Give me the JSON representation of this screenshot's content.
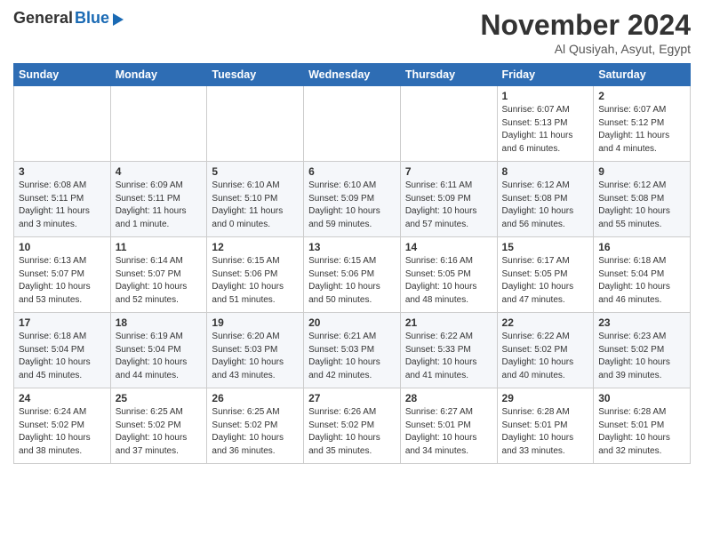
{
  "header": {
    "logo_general": "General",
    "logo_blue": "Blue",
    "month_title": "November 2024",
    "location": "Al Qusiyah, Asyut, Egypt"
  },
  "weekdays": [
    "Sunday",
    "Monday",
    "Tuesday",
    "Wednesday",
    "Thursday",
    "Friday",
    "Saturday"
  ],
  "weeks": [
    [
      {
        "day": "",
        "info": ""
      },
      {
        "day": "",
        "info": ""
      },
      {
        "day": "",
        "info": ""
      },
      {
        "day": "",
        "info": ""
      },
      {
        "day": "",
        "info": ""
      },
      {
        "day": "1",
        "info": "Sunrise: 6:07 AM\nSunset: 5:13 PM\nDaylight: 11 hours\nand 6 minutes."
      },
      {
        "day": "2",
        "info": "Sunrise: 6:07 AM\nSunset: 5:12 PM\nDaylight: 11 hours\nand 4 minutes."
      }
    ],
    [
      {
        "day": "3",
        "info": "Sunrise: 6:08 AM\nSunset: 5:11 PM\nDaylight: 11 hours\nand 3 minutes."
      },
      {
        "day": "4",
        "info": "Sunrise: 6:09 AM\nSunset: 5:11 PM\nDaylight: 11 hours\nand 1 minute."
      },
      {
        "day": "5",
        "info": "Sunrise: 6:10 AM\nSunset: 5:10 PM\nDaylight: 11 hours\nand 0 minutes."
      },
      {
        "day": "6",
        "info": "Sunrise: 6:10 AM\nSunset: 5:09 PM\nDaylight: 10 hours\nand 59 minutes."
      },
      {
        "day": "7",
        "info": "Sunrise: 6:11 AM\nSunset: 5:09 PM\nDaylight: 10 hours\nand 57 minutes."
      },
      {
        "day": "8",
        "info": "Sunrise: 6:12 AM\nSunset: 5:08 PM\nDaylight: 10 hours\nand 56 minutes."
      },
      {
        "day": "9",
        "info": "Sunrise: 6:12 AM\nSunset: 5:08 PM\nDaylight: 10 hours\nand 55 minutes."
      }
    ],
    [
      {
        "day": "10",
        "info": "Sunrise: 6:13 AM\nSunset: 5:07 PM\nDaylight: 10 hours\nand 53 minutes."
      },
      {
        "day": "11",
        "info": "Sunrise: 6:14 AM\nSunset: 5:07 PM\nDaylight: 10 hours\nand 52 minutes."
      },
      {
        "day": "12",
        "info": "Sunrise: 6:15 AM\nSunset: 5:06 PM\nDaylight: 10 hours\nand 51 minutes."
      },
      {
        "day": "13",
        "info": "Sunrise: 6:15 AM\nSunset: 5:06 PM\nDaylight: 10 hours\nand 50 minutes."
      },
      {
        "day": "14",
        "info": "Sunrise: 6:16 AM\nSunset: 5:05 PM\nDaylight: 10 hours\nand 48 minutes."
      },
      {
        "day": "15",
        "info": "Sunrise: 6:17 AM\nSunset: 5:05 PM\nDaylight: 10 hours\nand 47 minutes."
      },
      {
        "day": "16",
        "info": "Sunrise: 6:18 AM\nSunset: 5:04 PM\nDaylight: 10 hours\nand 46 minutes."
      }
    ],
    [
      {
        "day": "17",
        "info": "Sunrise: 6:18 AM\nSunset: 5:04 PM\nDaylight: 10 hours\nand 45 minutes."
      },
      {
        "day": "18",
        "info": "Sunrise: 6:19 AM\nSunset: 5:04 PM\nDaylight: 10 hours\nand 44 minutes."
      },
      {
        "day": "19",
        "info": "Sunrise: 6:20 AM\nSunset: 5:03 PM\nDaylight: 10 hours\nand 43 minutes."
      },
      {
        "day": "20",
        "info": "Sunrise: 6:21 AM\nSunset: 5:03 PM\nDaylight: 10 hours\nand 42 minutes."
      },
      {
        "day": "21",
        "info": "Sunrise: 6:22 AM\nSunset: 5:33 PM\nDaylight: 10 hours\nand 41 minutes."
      },
      {
        "day": "22",
        "info": "Sunrise: 6:22 AM\nSunset: 5:02 PM\nDaylight: 10 hours\nand 40 minutes."
      },
      {
        "day": "23",
        "info": "Sunrise: 6:23 AM\nSunset: 5:02 PM\nDaylight: 10 hours\nand 39 minutes."
      }
    ],
    [
      {
        "day": "24",
        "info": "Sunrise: 6:24 AM\nSunset: 5:02 PM\nDaylight: 10 hours\nand 38 minutes."
      },
      {
        "day": "25",
        "info": "Sunrise: 6:25 AM\nSunset: 5:02 PM\nDaylight: 10 hours\nand 37 minutes."
      },
      {
        "day": "26",
        "info": "Sunrise: 6:25 AM\nSunset: 5:02 PM\nDaylight: 10 hours\nand 36 minutes."
      },
      {
        "day": "27",
        "info": "Sunrise: 6:26 AM\nSunset: 5:02 PM\nDaylight: 10 hours\nand 35 minutes."
      },
      {
        "day": "28",
        "info": "Sunrise: 6:27 AM\nSunset: 5:01 PM\nDaylight: 10 hours\nand 34 minutes."
      },
      {
        "day": "29",
        "info": "Sunrise: 6:28 AM\nSunset: 5:01 PM\nDaylight: 10 hours\nand 33 minutes."
      },
      {
        "day": "30",
        "info": "Sunrise: 6:28 AM\nSunset: 5:01 PM\nDaylight: 10 hours\nand 32 minutes."
      }
    ]
  ]
}
